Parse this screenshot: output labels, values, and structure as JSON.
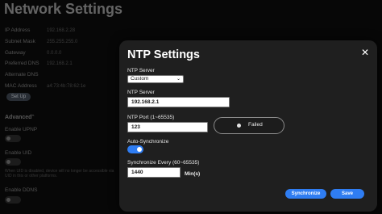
{
  "background": {
    "title": "Network Settings",
    "rows": [
      {
        "label": "IP Address",
        "value": "192.168.2.28"
      },
      {
        "label": "Subnet Mask",
        "value": "255.255.255.0"
      },
      {
        "label": "Gateway",
        "value": "0.0.0.0"
      },
      {
        "label": "Preferred DNS",
        "value": "192.168.2.1"
      },
      {
        "label": "Alternate DNS",
        "value": ""
      },
      {
        "label": "MAC Address",
        "value": "a4:73:4b:78:62:1e"
      }
    ],
    "setup_button": "Set Up",
    "advanced_label": "Advanced",
    "upnp_label": "Enable UPNP",
    "uid_label": "Enable UID",
    "uid_note": "When UID is disabled, device will no longer be accessible via UID in this or other platforms.",
    "ddns_label": "Enable DDNS"
  },
  "dialog": {
    "title": "NTP Settings",
    "ntp_server_select_label": "NTP Server",
    "ntp_server_select_value": "Custom",
    "ntp_server_input_label": "NTP Server",
    "ntp_server_input_value": "192.168.2.1",
    "ntp_port_label": "NTP Port (1~65535)",
    "ntp_port_value": "123",
    "status_text": "Failed",
    "auto_sync_label": "Auto-Synchronize",
    "auto_sync_enabled": true,
    "sync_every_label": "Synchronize Every (60~65535)",
    "sync_every_value": "1440",
    "sync_every_unit": "Min(s)",
    "synchronize_button": "Synchronize",
    "save_button": "Save",
    "close_icon": "close-icon",
    "accent_color": "#2f7df2"
  }
}
